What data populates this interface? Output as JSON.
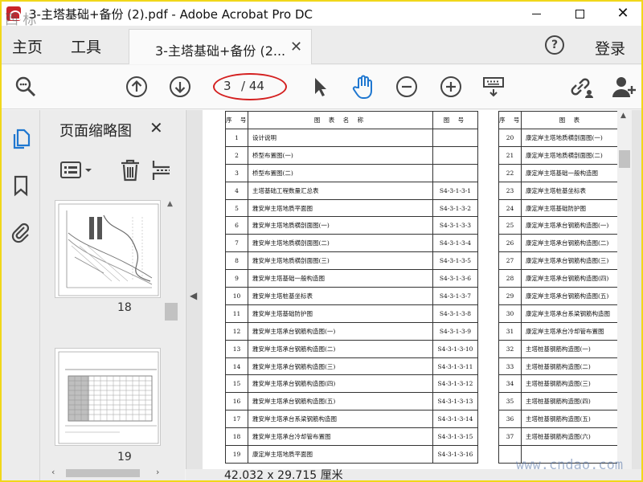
{
  "window": {
    "title": "3-主塔基础+备份 (2).pdf - Adobe Acrobat Pro DC",
    "corner_mark": "西 标",
    "controls": {
      "minimize": "",
      "maximize": "",
      "close": "✕"
    }
  },
  "menubar": {
    "home": "主页",
    "tools": "工具",
    "tab_label": "3-主塔基础+备份 (2...",
    "tab_close": "✕",
    "help": "?",
    "login": "登录"
  },
  "toolbar": {
    "page_current": "3",
    "page_total": "/ 44",
    "icons": [
      "zoom-search-icon",
      "page-up-icon",
      "page-down-icon",
      "select-arrow-icon",
      "hand-tool-icon",
      "zoom-out-icon",
      "zoom-in-icon",
      "keyboard-icon",
      "share-link-icon",
      "add-user-icon"
    ]
  },
  "thumbnail_panel": {
    "title": "页面缩略图",
    "close": "✕",
    "pages": [
      {
        "number": "18"
      },
      {
        "number": "19"
      }
    ]
  },
  "document": {
    "header": {
      "seq": "序 号",
      "name": "图 表 名 称",
      "figno": "图 号"
    },
    "header_right": {
      "seq": "序 号",
      "name": "图 表"
    },
    "left_rows": [
      {
        "seq": "1",
        "name": "设计说明",
        "figno": ""
      },
      {
        "seq": "2",
        "name": "桥型布置图(一)",
        "figno": ""
      },
      {
        "seq": "3",
        "name": "桥型布置图(二)",
        "figno": ""
      },
      {
        "seq": "4",
        "name": "主塔基础工程数量汇总表",
        "figno": "S4-3-1-3-1"
      },
      {
        "seq": "5",
        "name": "雅安岸主塔地质平面图",
        "figno": "S4-3-1-3-2"
      },
      {
        "seq": "6",
        "name": "雅安岸主塔地质横剖面图(一)",
        "figno": "S4-3-1-3-3"
      },
      {
        "seq": "7",
        "name": "雅安岸主塔地质横剖面图(二)",
        "figno": "S4-3-1-3-4"
      },
      {
        "seq": "8",
        "name": "雅安岸主塔地质横剖面图(三)",
        "figno": "S4-3-1-3-5"
      },
      {
        "seq": "9",
        "name": "雅安岸主塔基础一般构造图",
        "figno": "S4-3-1-3-6"
      },
      {
        "seq": "10",
        "name": "雅安岸主塔桩基坐标表",
        "figno": "S4-3-1-3-7"
      },
      {
        "seq": "11",
        "name": "雅安岸主塔基础防护图",
        "figno": "S4-3-1-3-8"
      },
      {
        "seq": "12",
        "name": "雅安岸主塔承台钢筋构造图(一)",
        "figno": "S4-3-1-3-9"
      },
      {
        "seq": "13",
        "name": "雅安岸主塔承台钢筋构造图(二)",
        "figno": "S4-3-1-3-10"
      },
      {
        "seq": "14",
        "name": "雅安岸主塔承台钢筋构造图(三)",
        "figno": "S4-3-1-3-11"
      },
      {
        "seq": "15",
        "name": "雅安岸主塔承台钢筋构造图(四)",
        "figno": "S4-3-1-3-12"
      },
      {
        "seq": "16",
        "name": "雅安岸主塔承台钢筋构造图(五)",
        "figno": "S4-3-1-3-13"
      },
      {
        "seq": "17",
        "name": "雅安岸主塔承台系梁钢筋构造图",
        "figno": "S4-3-1-3-14"
      },
      {
        "seq": "18",
        "name": "雅安岸主塔承台冷却管布置图",
        "figno": "S4-3-1-3-15"
      },
      {
        "seq": "19",
        "name": "康定岸主塔地质平面图",
        "figno": "S4-3-1-3-16"
      }
    ],
    "right_rows": [
      {
        "seq": "20",
        "name": "康定岸主塔地质横剖面图(一)"
      },
      {
        "seq": "21",
        "name": "康定岸主塔地质横剖面图(二)"
      },
      {
        "seq": "22",
        "name": "康定岸主塔基础一般构造图"
      },
      {
        "seq": "23",
        "name": "康定岸主塔桩基坐标表"
      },
      {
        "seq": "24",
        "name": "康定岸主塔基础防护图"
      },
      {
        "seq": "25",
        "name": "康定岸主塔承台钢筋构造图(一)"
      },
      {
        "seq": "26",
        "name": "康定岸主塔承台钢筋构造图(二)"
      },
      {
        "seq": "27",
        "name": "康定岸主塔承台钢筋构造图(三)"
      },
      {
        "seq": "28",
        "name": "康定岸主塔承台钢筋构造图(四)"
      },
      {
        "seq": "29",
        "name": "康定岸主塔承台钢筋构造图(五)"
      },
      {
        "seq": "30",
        "name": "康定岸主塔承台系梁钢筋构造图"
      },
      {
        "seq": "31",
        "name": "康定岸主塔承台冷却管布置图"
      },
      {
        "seq": "32",
        "name": "主塔桩基钢筋构造图(一)"
      },
      {
        "seq": "33",
        "name": "主塔桩基钢筋构造图(二)"
      },
      {
        "seq": "34",
        "name": "主塔桩基钢筋构造图(三)"
      },
      {
        "seq": "35",
        "name": "主塔桩基钢筋构造图(四)"
      },
      {
        "seq": "36",
        "name": "主塔桩基钢筋构造图(五)"
      },
      {
        "seq": "37",
        "name": "主塔桩基钢筋构造图(六)"
      },
      {
        "seq": "",
        "name": ""
      }
    ]
  },
  "statusbar": {
    "dimensions": "42.032 x 29.715 厘米"
  },
  "watermark": "www.cndao.com",
  "colors": {
    "accent_blue": "#1f77d0",
    "annotation_red": "#d42020",
    "frame_yellow": "#f1d71a"
  }
}
